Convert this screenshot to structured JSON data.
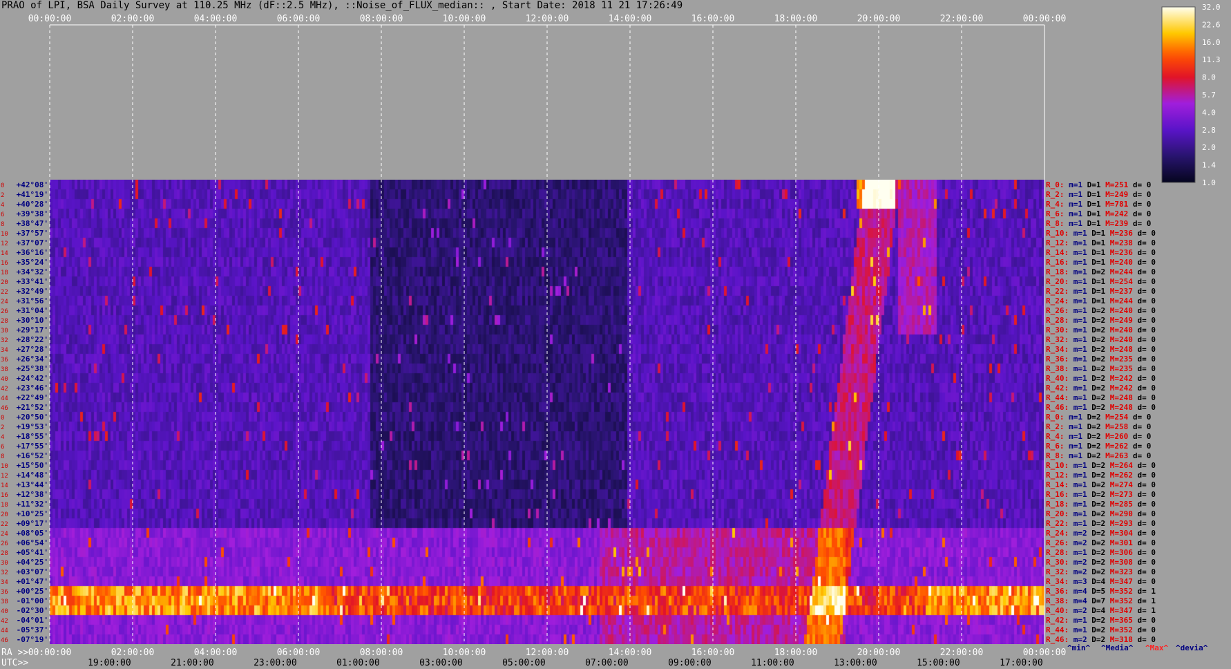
{
  "title": "PRAO of LPI, BSA Daily Survey at 110.25 MHz (dF::2.5 MHz), ::Noise_of_FLUX_median:: , Start Date: 2018 11 21 17:26:49",
  "chart_data": {
    "type": "heatmap",
    "title": "PRAO of LPI, BSA Daily Survey at 110.25 MHz (dF::2.5 MHz), ::Noise_of_FLUX_median:: , Start Date: 2018 11 21 17:26:49",
    "x_top_ticks": [
      "00:00:00",
      "02:00:00",
      "04:00:00",
      "06:00:00",
      "08:00:00",
      "10:00:00",
      "12:00:00",
      "14:00:00",
      "16:00:00",
      "18:00:00",
      "20:00:00",
      "22:00:00",
      "00:00:00"
    ],
    "x_ra_ticks": [
      "00:00:00",
      "02:00:00",
      "04:00:00",
      "06:00:00",
      "08:00:00",
      "10:00:00",
      "12:00:00",
      "14:00:00",
      "16:00:00",
      "18:00:00",
      "20:00:00",
      "22:00:00",
      "00:00:00"
    ],
    "x_utc_ticks": [
      "19:00:00",
      "21:00:00",
      "23:00:00",
      "01:00:00",
      "03:00:00",
      "05:00:00",
      "07:00:00",
      "09:00:00",
      "11:00:00",
      "13:00:00",
      "15:00:00",
      "17:00:00"
    ],
    "ra_axis_label": "RA >>",
    "utc_axis_label": "UTC>>",
    "declinations": [
      "+42°08'",
      "+41°19'",
      "+40°28'",
      "+39°38'",
      "+38°47'",
      "+37°57'",
      "+37°07'",
      "+36°16'",
      "+35°24'",
      "+34°32'",
      "+33°41'",
      "+32°49'",
      "+31°56'",
      "+31°04'",
      "+30°10'",
      "+29°17'",
      "+28°22'",
      "+27°28'",
      "+26°34'",
      "+25°38'",
      "+24°42'",
      "+23°46'",
      "+22°49'",
      "+21°52'",
      "+20°50'",
      "+19°53'",
      "+18°55'",
      "+17°55'",
      "+16°52'",
      "+15°50'",
      "+14°48'",
      "+13°44'",
      "+12°38'",
      "+11°32'",
      "+10°25'",
      "+09°17'",
      "+08°05'",
      "+06°54'",
      "+05°41'",
      "+04°25'",
      "+03°07'",
      "+01°47'",
      "+00°25'",
      "-01°00'",
      "-02°30'",
      "-04°01'",
      "-05°37'",
      "-07°19'"
    ],
    "row_indices": [
      "0",
      "2",
      "4",
      "6",
      "8",
      "10",
      "12",
      "14",
      "16",
      "18",
      "20",
      "22",
      "24",
      "26",
      "28",
      "30",
      "32",
      "34",
      "36",
      "38",
      "40",
      "42",
      "44",
      "46",
      "0",
      "2",
      "4",
      "6",
      "8",
      "10",
      "12",
      "14",
      "16",
      "18",
      "20",
      "22",
      "24",
      "26",
      "28",
      "30",
      "32",
      "34",
      "36",
      "38",
      "40",
      "42",
      "44",
      "46"
    ],
    "row_stats": [
      {
        "r": "R_0:",
        "m": "m=1",
        "D": "D=1",
        "M": "M=251",
        "d": "d= 0"
      },
      {
        "r": "R_2:",
        "m": "m=1",
        "D": "D=1",
        "M": "M=249",
        "d": "d= 0"
      },
      {
        "r": "R_4:",
        "m": "m=1",
        "D": "D=1",
        "M": "M=781",
        "d": "d= 0"
      },
      {
        "r": "R_6:",
        "m": "m=1",
        "D": "D=1",
        "M": "M=242",
        "d": "d= 0"
      },
      {
        "r": "R_8:",
        "m": "m=1",
        "D": "D=1",
        "M": "M=239",
        "d": "d= 0"
      },
      {
        "r": "R_10:",
        "m": "m=1",
        "D": "D=1",
        "M": "M=236",
        "d": "d= 0"
      },
      {
        "r": "R_12:",
        "m": "m=1",
        "D": "D=1",
        "M": "M=238",
        "d": "d= 0"
      },
      {
        "r": "R_14:",
        "m": "m=1",
        "D": "D=1",
        "M": "M=236",
        "d": "d= 0"
      },
      {
        "r": "R_16:",
        "m": "m=1",
        "D": "D=1",
        "M": "M=240",
        "d": "d= 0"
      },
      {
        "r": "R_18:",
        "m": "m=1",
        "D": "D=2",
        "M": "M=244",
        "d": "d= 0"
      },
      {
        "r": "R_20:",
        "m": "m=1",
        "D": "D=1",
        "M": "M=254",
        "d": "d= 0"
      },
      {
        "r": "R_22:",
        "m": "m=1",
        "D": "D=1",
        "M": "M=237",
        "d": "d= 0"
      },
      {
        "r": "R_24:",
        "m": "m=1",
        "D": "D=1",
        "M": "M=244",
        "d": "d= 0"
      },
      {
        "r": "R_26:",
        "m": "m=1",
        "D": "D=2",
        "M": "M=240",
        "d": "d= 0"
      },
      {
        "r": "R_28:",
        "m": "m=1",
        "D": "D=2",
        "M": "M=249",
        "d": "d= 0"
      },
      {
        "r": "R_30:",
        "m": "m=1",
        "D": "D=2",
        "M": "M=240",
        "d": "d= 0"
      },
      {
        "r": "R_32:",
        "m": "m=1",
        "D": "D=2",
        "M": "M=240",
        "d": "d= 0"
      },
      {
        "r": "R_34:",
        "m": "m=1",
        "D": "D=2",
        "M": "M=248",
        "d": "d= 0"
      },
      {
        "r": "R_36:",
        "m": "m=1",
        "D": "D=2",
        "M": "M=235",
        "d": "d= 0"
      },
      {
        "r": "R_38:",
        "m": "m=1",
        "D": "D=2",
        "M": "M=235",
        "d": "d= 0"
      },
      {
        "r": "R_40:",
        "m": "m=1",
        "D": "D=2",
        "M": "M=242",
        "d": "d= 0"
      },
      {
        "r": "R_42:",
        "m": "m=1",
        "D": "D=2",
        "M": "M=242",
        "d": "d= 0"
      },
      {
        "r": "R_44:",
        "m": "m=1",
        "D": "D=2",
        "M": "M=248",
        "d": "d= 0"
      },
      {
        "r": "R_46:",
        "m": "m=1",
        "D": "D=2",
        "M": "M=248",
        "d": "d= 0"
      },
      {
        "r": "R_0:",
        "m": "m=1",
        "D": "D=2",
        "M": "M=254",
        "d": "d= 0"
      },
      {
        "r": "R_2:",
        "m": "m=1",
        "D": "D=2",
        "M": "M=258",
        "d": "d= 0"
      },
      {
        "r": "R_4:",
        "m": "m=1",
        "D": "D=2",
        "M": "M=260",
        "d": "d= 0"
      },
      {
        "r": "R_6:",
        "m": "m=1",
        "D": "D=2",
        "M": "M=262",
        "d": "d= 0"
      },
      {
        "r": "R_8:",
        "m": "m=1",
        "D": "D=2",
        "M": "M=263",
        "d": "d= 0"
      },
      {
        "r": "R_10:",
        "m": "m=1",
        "D": "D=2",
        "M": "M=264",
        "d": "d= 0"
      },
      {
        "r": "R_12:",
        "m": "m=1",
        "D": "D=2",
        "M": "M=262",
        "d": "d= 0"
      },
      {
        "r": "R_14:",
        "m": "m=1",
        "D": "D=2",
        "M": "M=274",
        "d": "d= 0"
      },
      {
        "r": "R_16:",
        "m": "m=1",
        "D": "D=2",
        "M": "M=273",
        "d": "d= 0"
      },
      {
        "r": "R_18:",
        "m": "m=1",
        "D": "D=2",
        "M": "M=285",
        "d": "d= 0"
      },
      {
        "r": "R_20:",
        "m": "m=1",
        "D": "D=2",
        "M": "M=290",
        "d": "d= 0"
      },
      {
        "r": "R_22:",
        "m": "m=1",
        "D": "D=2",
        "M": "M=293",
        "d": "d= 0"
      },
      {
        "r": "R_24:",
        "m": "m=2",
        "D": "D=2",
        "M": "M=304",
        "d": "d= 0"
      },
      {
        "r": "R_26:",
        "m": "m=2",
        "D": "D=2",
        "M": "M=301",
        "d": "d= 0"
      },
      {
        "r": "R_28:",
        "m": "m=1",
        "D": "D=2",
        "M": "M=306",
        "d": "d= 0"
      },
      {
        "r": "R_30:",
        "m": "m=2",
        "D": "D=2",
        "M": "M=308",
        "d": "d= 0"
      },
      {
        "r": "R_32:",
        "m": "m=2",
        "D": "D=2",
        "M": "M=323",
        "d": "d= 0"
      },
      {
        "r": "R_34:",
        "m": "m=3",
        "D": "D=4",
        "M": "M=347",
        "d": "d= 0"
      },
      {
        "r": "R_36:",
        "m": "m=4",
        "D": "D=5",
        "M": "M=352",
        "d": "d= 1"
      },
      {
        "r": "R_38:",
        "m": "m=4",
        "D": "D=7",
        "M": "M=352",
        "d": "d= 1"
      },
      {
        "r": "R_40:",
        "m": "m=2",
        "D": "D=4",
        "M": "M=347",
        "d": "d= 1"
      },
      {
        "r": "R_42:",
        "m": "m=1",
        "D": "D=2",
        "M": "M=365",
        "d": "d= 0"
      },
      {
        "r": "R_44:",
        "m": "m=1",
        "D": "D=2",
        "M": "M=352",
        "d": "d= 0"
      },
      {
        "r": "R_46:",
        "m": "m=2",
        "D": "D=2",
        "M": "M=318",
        "d": "d= 0"
      }
    ],
    "legend_keys": {
      "min": "^min^",
      "media": "^Media^",
      "max": "^Max^",
      "devia": "^devia^"
    },
    "colorbar_ticks": [
      "32.0",
      "22.6",
      "16.0",
      "11.3",
      "8.0",
      "5.7",
      "4.0",
      "2.8",
      "2.0",
      "1.4",
      "1.0"
    ],
    "colorbar_range": [
      1.0,
      32.0
    ],
    "colorbar_scale": "log",
    "colors": {
      "background": "#a0a0a0",
      "index_label": "#d00000",
      "dec_label": "#000080",
      "stat_red": "#e00000",
      "stat_blue": "#000080",
      "max_label": "#ff2020"
    },
    "features": [
      {
        "name": "horizontal bright band",
        "dec_from": "+00°25'",
        "dec_to": "-02°30'",
        "ra_from": "00:00:00",
        "ra_to": "24:00:00"
      },
      {
        "name": "bright source",
        "dec": "+40°28'",
        "ra": "20:00:00"
      },
      {
        "name": "diagonal streak",
        "ra_from": "18:40:00",
        "ra_to": "20:20:00",
        "dec_from": "-07°19'",
        "dec_to": "+42°08'"
      }
    ]
  }
}
